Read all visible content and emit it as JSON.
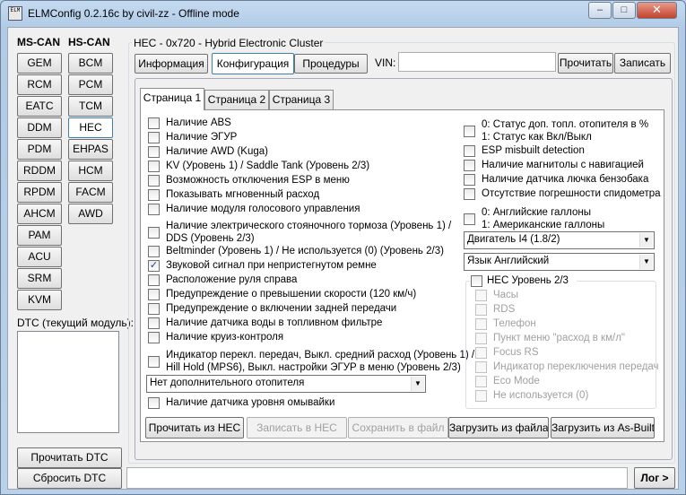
{
  "window": {
    "title": "ELMConfig 0.2.16c by civil-zz - Offline mode",
    "icon_text": "ELM",
    "minimize": "–",
    "maximize": "□",
    "close": "✕"
  },
  "modules": {
    "ms_can_label": "MS-CAN",
    "hs_can_label": "HS-CAN",
    "ms_can": [
      "GEM",
      "RCM",
      "EATC",
      "DDM",
      "PDM",
      "RDDM",
      "RPDM",
      "AHCM",
      "PAM",
      "ACU",
      "SRM",
      "KVM"
    ],
    "hs_can": [
      "BCM",
      "PCM",
      "TCM",
      "HEC",
      "EHPAS",
      "HCM",
      "FACM",
      "AWD"
    ],
    "selected": "HEC"
  },
  "dtc": {
    "label": "DTC (текущий модуль):",
    "read_button": "Прочитать DTC",
    "reset_button": "Сбросить DTC"
  },
  "module_panel": {
    "group_title": "HEC - 0x720 - Hybrid Electronic Cluster",
    "tabs": [
      "Информация",
      "Конфигурация",
      "Процедуры"
    ],
    "active_tab": "Конфигурация",
    "vin_label": "VIN:",
    "vin_value": "",
    "read_button": "Прочитать",
    "write_button": "Записать"
  },
  "pages": {
    "tabs": [
      "Страница 1",
      "Страница 2",
      "Страница 3"
    ],
    "active": "Страница 1"
  },
  "left_options": [
    {
      "label": "Наличие ABS",
      "checked": false
    },
    {
      "label": "Наличие ЭГУР",
      "checked": false
    },
    {
      "label": "Наличие AWD (Kuga)",
      "checked": false
    },
    {
      "label": "KV (Уровень 1) / Saddle Tank (Уровень 2/3)",
      "checked": false
    },
    {
      "label": "Возможность отключения ESP в меню",
      "checked": false
    },
    {
      "label": "Показывать мгновенный расход",
      "checked": false
    },
    {
      "label": "Наличие модуля голосового управления",
      "checked": false
    },
    {
      "label": "Наличие электрического стояночного тормоза (Уровень 1) /",
      "label2": "DDS (Уровень 2/3)",
      "checked": false
    },
    {
      "label": "Beltminder (Уровень 1) / Не используется (0) (Уровень 2/3)",
      "checked": false
    },
    {
      "label": "Звуковой сигнал при непристегнутом ремне",
      "checked": true
    },
    {
      "label": "Расположение руля справа",
      "checked": false
    },
    {
      "label": "Предупреждение о превышении скорости (120 км/ч)",
      "checked": false
    },
    {
      "label": "Предупреждение о включении задней передачи",
      "checked": false
    },
    {
      "label": "Наличие датчика воды в топливном фильтре",
      "checked": false
    },
    {
      "label": "Наличие круиз-контроля",
      "checked": false
    },
    {
      "label": "Индикатор перекл. передач, Выкл. средний расход (Уровень 1) /",
      "label2": "Hill Hold (MPS6), Выкл. настройки ЭГУР в меню  (Уровень 2/3)",
      "checked": false
    }
  ],
  "heater_combo": "Нет дополнительного отопителя",
  "washer_option": {
    "label": "Наличие датчика уровня омывайки",
    "checked": false
  },
  "right_options": [
    {
      "label": "0: Статус доп. топл. отопителя в %",
      "label2": "1: Статус как Вкл/Выкл",
      "checked": false
    },
    {
      "label": "ESP misbuilt detection",
      "checked": false
    },
    {
      "label": "Наличие магнитолы с навигацией",
      "checked": false
    },
    {
      "label": "Наличие датчика лючка бензобака",
      "checked": false
    },
    {
      "label": "Отсутствие погрешности спидометра",
      "checked": false
    },
    {
      "label": "0: Английские галлоны",
      "label2": "1: Американские галлоны",
      "checked": false
    }
  ],
  "engine_combo": "Двигатель I4 (1.8/2)",
  "language_combo": "Язык Английский",
  "hec_level": {
    "title": "HEC Уровень 2/3",
    "checked": false,
    "items": [
      "Часы",
      "RDS",
      "Телефон",
      "Пункт меню \"расход в км/л\"",
      "Focus RS",
      "Индикатор переключения передач",
      "Eco Mode",
      "Не используется (0)"
    ]
  },
  "bottom_buttons": {
    "read_hec": "Прочитать из HEC",
    "write_hec": "Записать в HEC",
    "save_file": "Сохранить в файл",
    "load_file": "Загрузить из файла",
    "load_asbuilt": "Загрузить из As-Built"
  },
  "status": {
    "log_text": "",
    "log_button": "Лог >"
  },
  "ui": {
    "check_glyph": "✓",
    "combo_arrow": "▼"
  }
}
